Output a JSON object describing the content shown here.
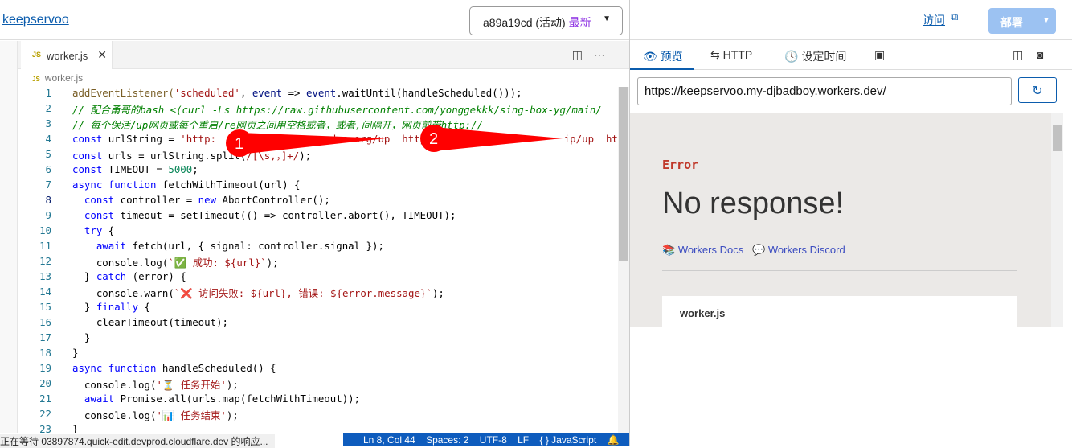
{
  "header": {
    "project": "keepservoo",
    "version": "a89a19cd (活动)",
    "version_badge": "最新",
    "visit": "访问",
    "deploy": "部署"
  },
  "editor": {
    "tab": "worker.js",
    "tab_icon": "JS",
    "breadcrumb": "worker.js",
    "lines": [
      [
        [
          "addEventListener(",
          "fn"
        ],
        [
          "'scheduled'",
          "st"
        ],
        [
          ", ",
          ""
        ],
        [
          "event",
          "vr"
        ],
        [
          " => ",
          ""
        ],
        [
          "event",
          "vr"
        ],
        [
          ".waitUntil(handleScheduled()));",
          ""
        ]
      ],
      [
        [
          "// 配合甬哥的bash <(curl -Ls https://raw.githubusercontent.com/yonggekkk/sing-box-yg/main/",
          "cm"
        ]
      ],
      [
        [
          "// 每个保活/up网页或每个重启/re网页之间用空格或者，或者,间隔开，网页前带http://",
          "cm"
        ]
      ],
      [
        [
          "const",
          "kw"
        ],
        [
          " urlString = ",
          ""
        ],
        [
          "'http:                  .dns.org/up  http                       ip/up  http://",
          "st"
        ]
      ],
      [
        [
          "const",
          "kw"
        ],
        [
          " urls = urlString.split(",
          ""
        ],
        [
          "/[\\s,，]+/",
          "st"
        ],
        [
          ");",
          ""
        ]
      ],
      [
        [
          "const",
          "kw"
        ],
        [
          " TIMEOUT = ",
          ""
        ],
        [
          "5000",
          "nu"
        ],
        [
          ";",
          ""
        ]
      ],
      [
        [
          "async function",
          "kw"
        ],
        [
          " fetchWithTimeout",
          ""
        ],
        [
          "(url) {",
          ""
        ]
      ],
      [
        [
          "  const",
          "kw"
        ],
        [
          " controller = ",
          ""
        ],
        [
          "new",
          "kw"
        ],
        [
          " AbortController();",
          ""
        ]
      ],
      [
        [
          "  const",
          "kw"
        ],
        [
          " timeout = setTimeout(() => controller.abort(), TIMEOUT);",
          ""
        ]
      ],
      [
        [
          "  try",
          "kw"
        ],
        [
          " {",
          ""
        ]
      ],
      [
        [
          "    await",
          "kw"
        ],
        [
          " fetch(url, { signal: controller.signal });",
          ""
        ]
      ],
      [
        [
          "    console.log(",
          ""
        ],
        [
          "`✅ 成功: ${url}`",
          "st"
        ],
        [
          ");",
          ""
        ]
      ],
      [
        [
          "  } ",
          ""
        ],
        [
          "catch",
          "kw"
        ],
        [
          " (error) {",
          ""
        ]
      ],
      [
        [
          "    console.warn(",
          ""
        ],
        [
          "`❌ 访问失败: ${url}, 错误: ${error.message}`",
          "st"
        ],
        [
          ");",
          ""
        ]
      ],
      [
        [
          "  } ",
          ""
        ],
        [
          "finally",
          "kw"
        ],
        [
          " {",
          ""
        ]
      ],
      [
        [
          "    clearTimeout(timeout);",
          ""
        ]
      ],
      [
        [
          "  }",
          ""
        ]
      ],
      [
        [
          "}",
          ""
        ]
      ],
      [
        [
          "async function",
          "kw"
        ],
        [
          " handleScheduled() {",
          ""
        ]
      ],
      [
        [
          "  console.log(",
          ""
        ],
        [
          "'⏳ 任务开始'",
          "st"
        ],
        [
          ");",
          ""
        ]
      ],
      [
        [
          "  await",
          "kw"
        ],
        [
          " Promise.all(urls.map(fetchWithTimeout));",
          ""
        ]
      ],
      [
        [
          "  console.log(",
          ""
        ],
        [
          "'📊 任务结束'",
          "st"
        ],
        [
          ");",
          ""
        ]
      ],
      [
        [
          "}",
          ""
        ]
      ]
    ]
  },
  "annotations": [
    "1",
    "2"
  ],
  "status": {
    "message": "正在等待 03897874.quick-edit.devprod.cloudflare.dev 的响应...",
    "position": "Ln 8, Col 44",
    "spaces": "Spaces: 2",
    "encoding": "UTF-8",
    "eol": "LF",
    "language": "{ } JavaScript"
  },
  "preview": {
    "tabs": [
      "预览",
      "HTTP",
      "设定时间"
    ],
    "url": "https://keepservoo.my-djbadboy.workers.dev/",
    "error_label": "Error",
    "error_title": "No response!",
    "links": [
      "Workers Docs",
      "Workers Discord"
    ],
    "card_title": "worker.js"
  }
}
